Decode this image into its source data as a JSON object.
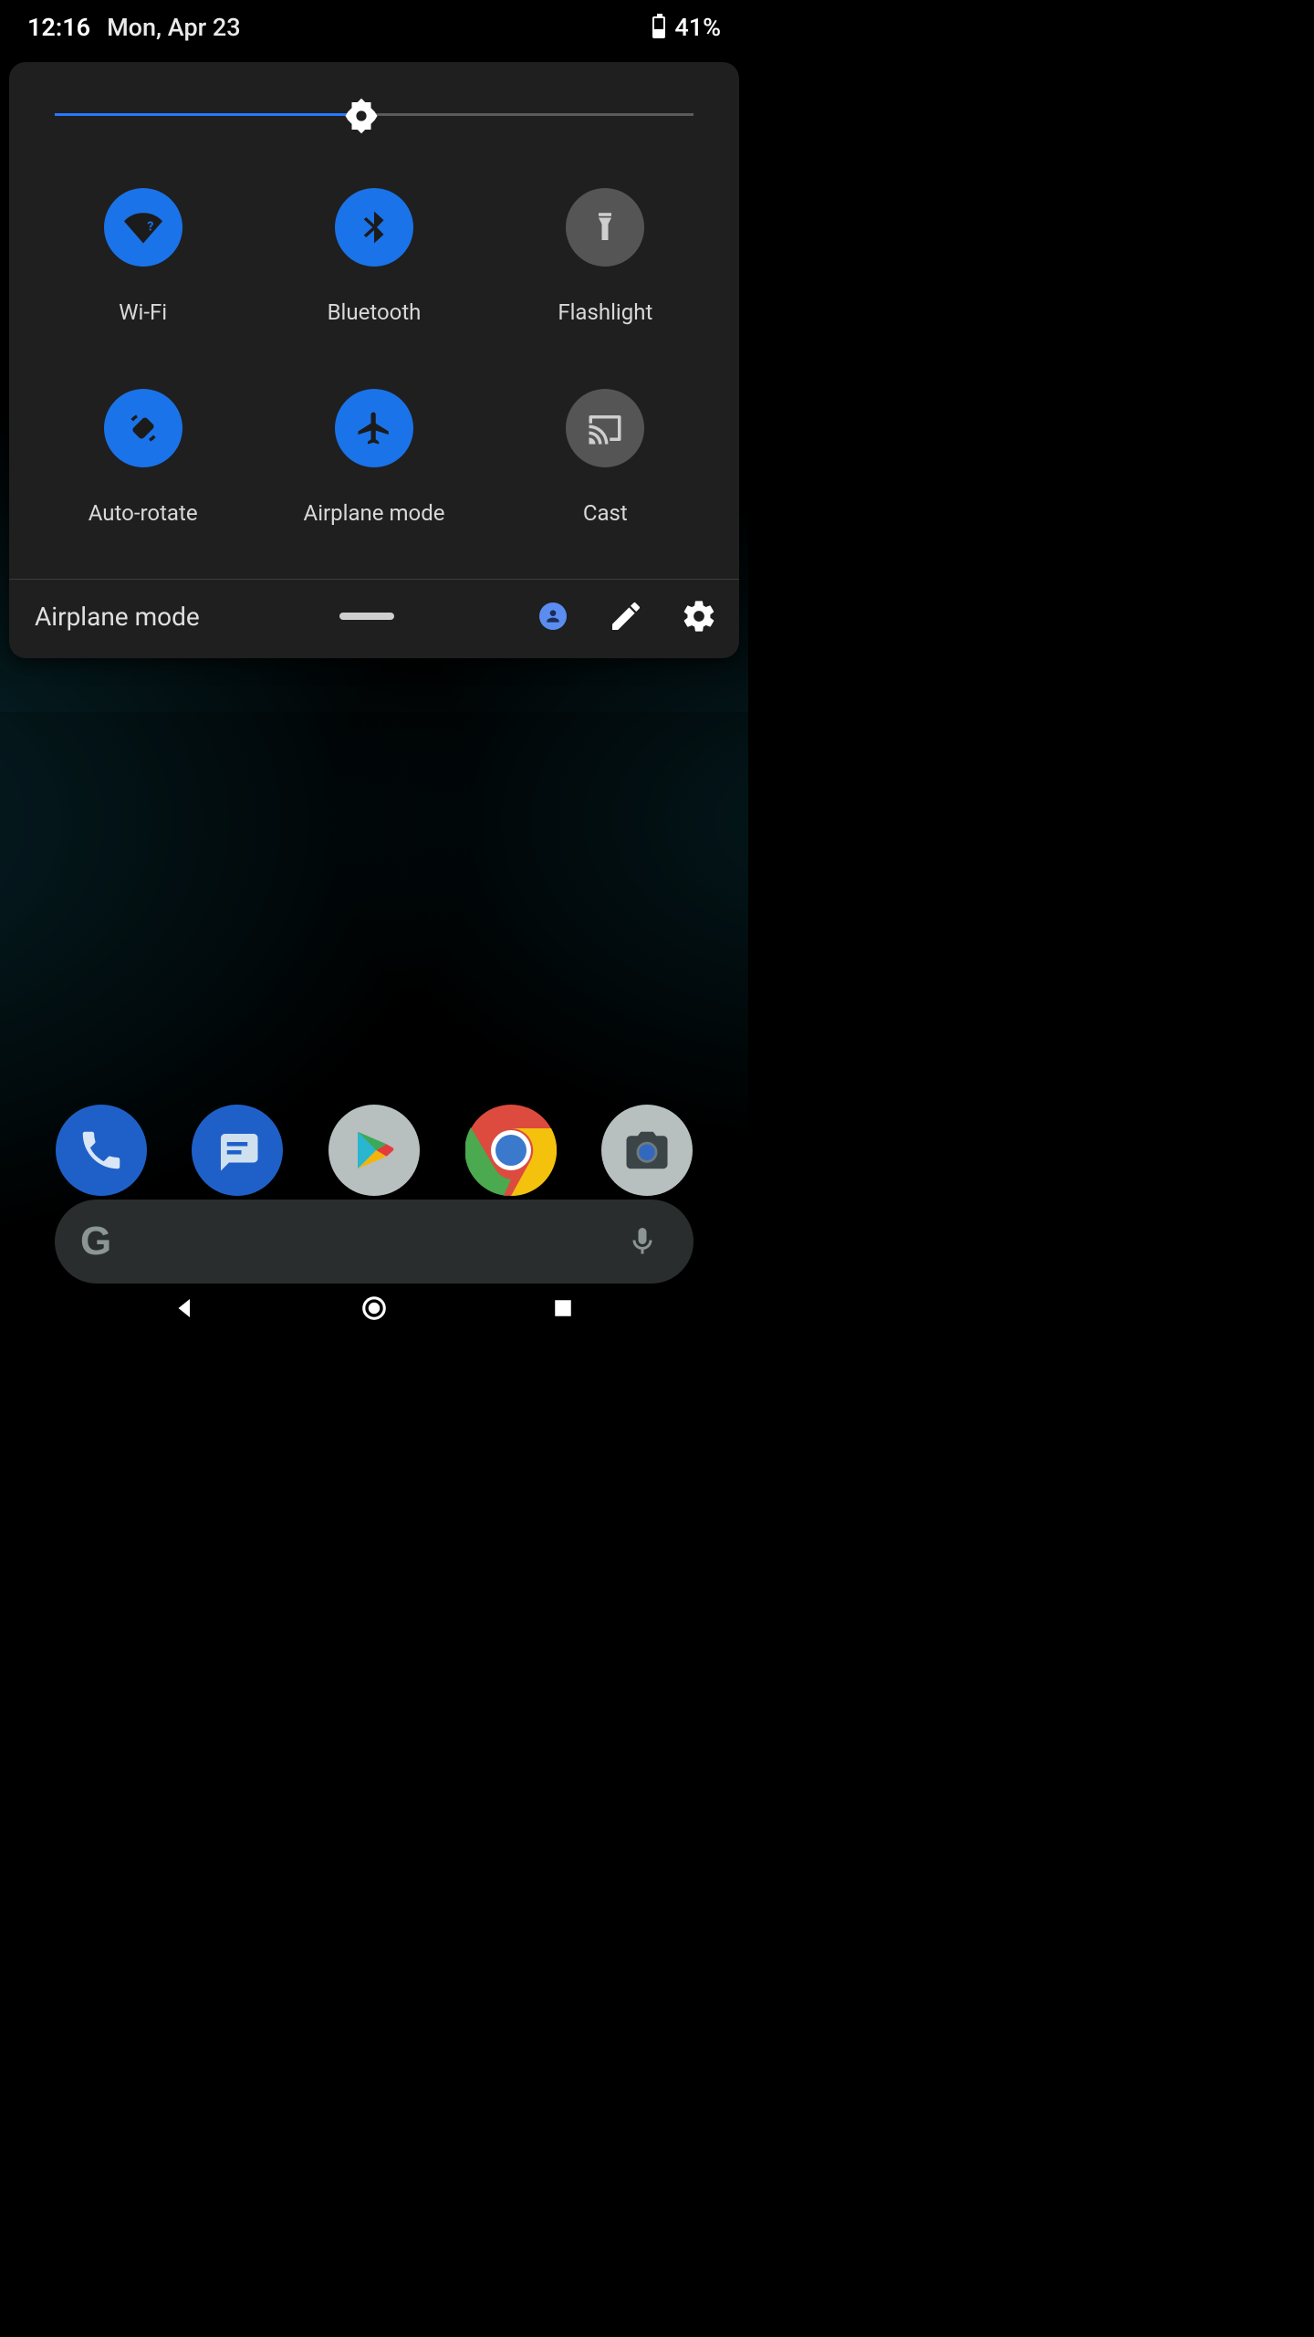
{
  "status": {
    "time": "12:16",
    "date": "Mon, Apr 23",
    "battery_pct": "41%",
    "battery_level": 0.41
  },
  "brightness": {
    "value": 0.48
  },
  "tiles": [
    {
      "id": "wifi",
      "label": "Wi-Fi",
      "active": true
    },
    {
      "id": "bluetooth",
      "label": "Bluetooth",
      "active": true
    },
    {
      "id": "flashlight",
      "label": "Flashlight",
      "active": false
    },
    {
      "id": "autorotate",
      "label": "Auto-rotate",
      "active": true
    },
    {
      "id": "airplane",
      "label": "Airplane mode",
      "active": true
    },
    {
      "id": "cast",
      "label": "Cast",
      "active": false
    }
  ],
  "footer": {
    "status_label": "Airplane mode"
  },
  "dock": [
    {
      "id": "phone"
    },
    {
      "id": "messages"
    },
    {
      "id": "play"
    },
    {
      "id": "chrome"
    },
    {
      "id": "camera"
    }
  ]
}
